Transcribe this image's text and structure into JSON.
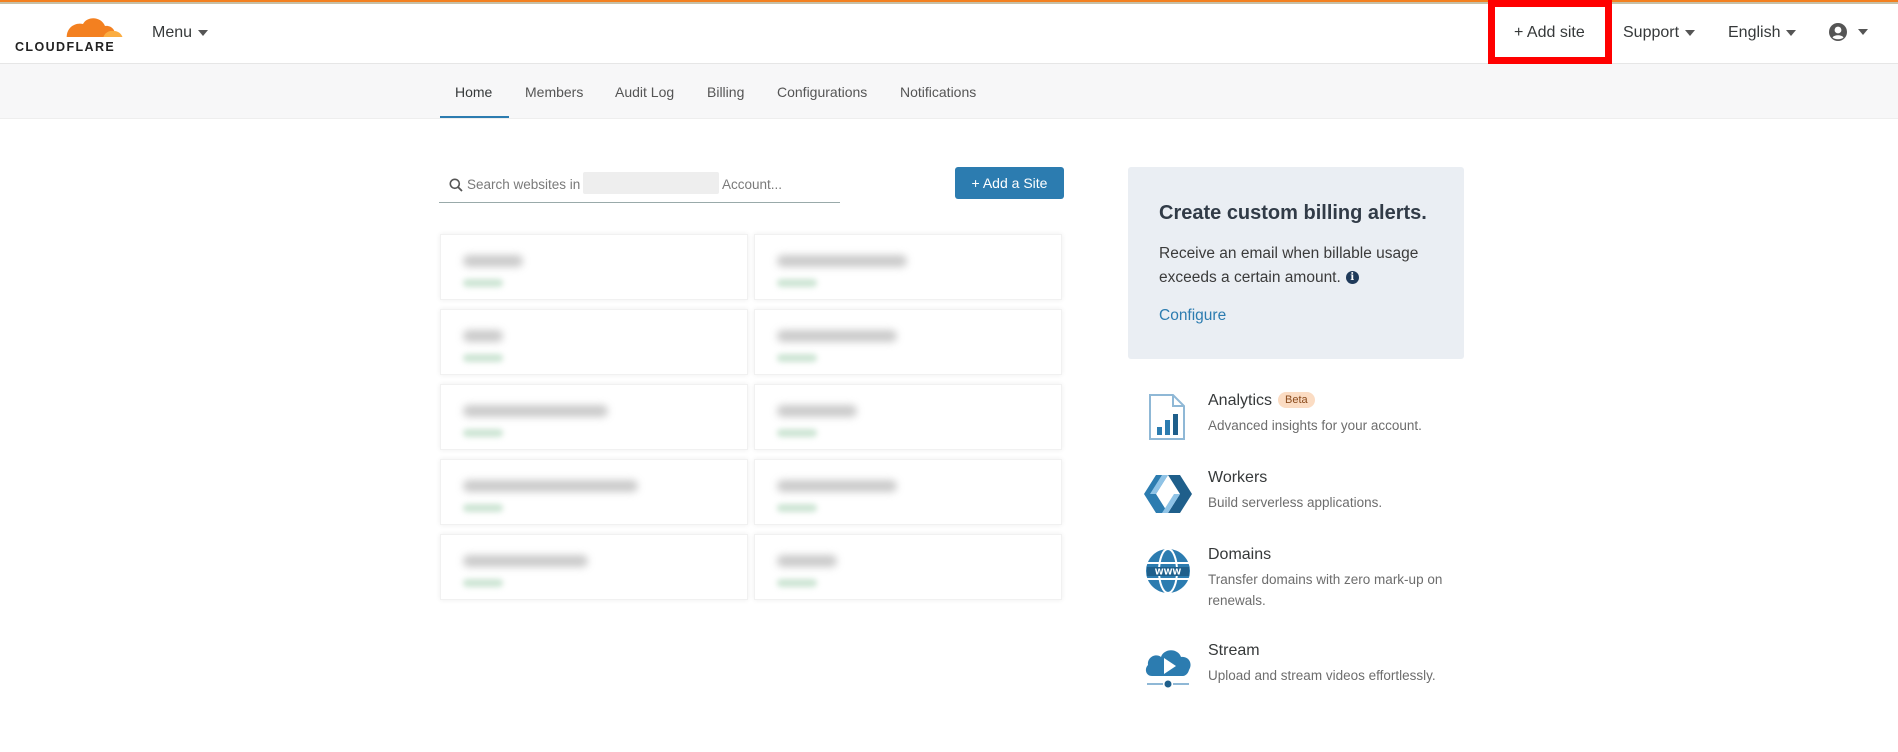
{
  "header": {
    "logo_text": "CLOUDFLARE",
    "menu_label": "Menu",
    "add_site_label": "+ Add site",
    "support_label": "Support",
    "language_label": "English"
  },
  "tabs": [
    "Home",
    "Members",
    "Audit Log",
    "Billing",
    "Configurations",
    "Notifications"
  ],
  "active_tab": "Home",
  "search": {
    "prefix": "Search websites in",
    "suffix": "Account..."
  },
  "add_a_site_button": "+ Add a Site",
  "billing_alert": {
    "title": "Create custom billing alerts.",
    "body": "Receive an email when billable usage exceeds a certain amount.",
    "link": "Configure"
  },
  "products": [
    {
      "name": "Analytics",
      "badge": "Beta",
      "description": "Advanced insights for your account.",
      "icon": "analytics-icon"
    },
    {
      "name": "Workers",
      "description": "Build serverless applications.",
      "icon": "workers-icon"
    },
    {
      "name": "Domains",
      "description": "Transfer domains with zero mark-up on renewals.",
      "icon": "domains-icon"
    },
    {
      "name": "Stream",
      "description": "Upload and stream videos effortlessly.",
      "icon": "stream-icon"
    }
  ],
  "colors": {
    "accent": "#2c7cb0",
    "brand_orange": "#f38020",
    "highlight_red": "#ff0000"
  }
}
